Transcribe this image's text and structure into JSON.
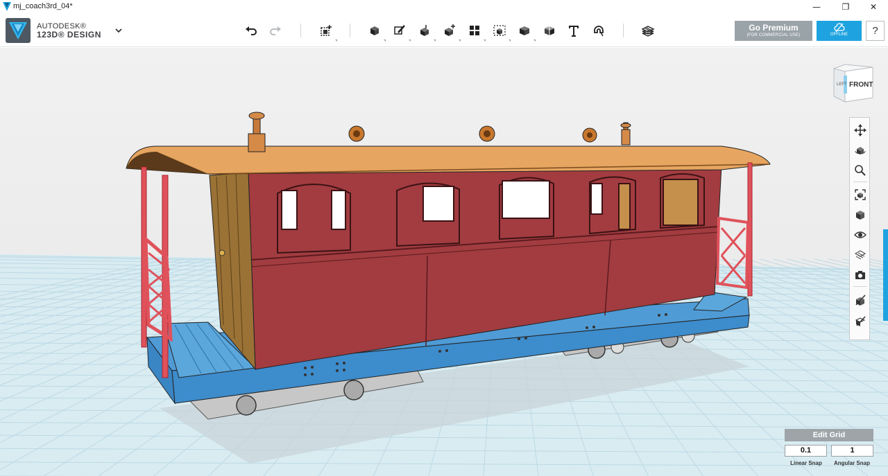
{
  "window": {
    "title": "mj_coach3rd_04*",
    "minimize_glyph": "—",
    "maximize_glyph": "❐",
    "close_glyph": "✕"
  },
  "brand": {
    "line1": "AUTODESK®",
    "line2": "123D® DESIGN"
  },
  "toolbar": {
    "items": [
      "undo-icon",
      "redo-icon",
      "transform-icon",
      "primitives-icon",
      "sketch-icon",
      "construct-icon",
      "modify-icon",
      "pattern-icon",
      "grouping-icon",
      "combine-icon",
      "measure-icon",
      "text-icon",
      "snap-icon",
      "material-icon"
    ]
  },
  "premium": {
    "label": "Go Premium",
    "sublabel": "(FOR COMMERCIAL USE)"
  },
  "offline": {
    "sublabel": "OFFLINE"
  },
  "help": {
    "label": "?"
  },
  "viewcube": {
    "front_label": "FRONT",
    "left_label": "LEFT"
  },
  "nav": {
    "items": [
      "pan-icon",
      "orbit-icon",
      "zoom-icon",
      "fit-icon",
      "views-icon",
      "visibility-icon",
      "material-view-icon",
      "camera-icon",
      "tweak-icon",
      "snap-edit-icon"
    ]
  },
  "grid": {
    "edit_label": "Edit Grid",
    "linear_snap_value": "0.1",
    "angular_snap_value": "1",
    "linear_snap_label": "Linear Snap",
    "angular_snap_label": "Angular Snap"
  },
  "colors": {
    "accent": "#1ea3e0",
    "premium_bg": "#9aa3a8",
    "coach_body": "#a23c40",
    "roof": "#e6a560",
    "frame": "#3a8ccc",
    "railing": "#e0525b"
  }
}
